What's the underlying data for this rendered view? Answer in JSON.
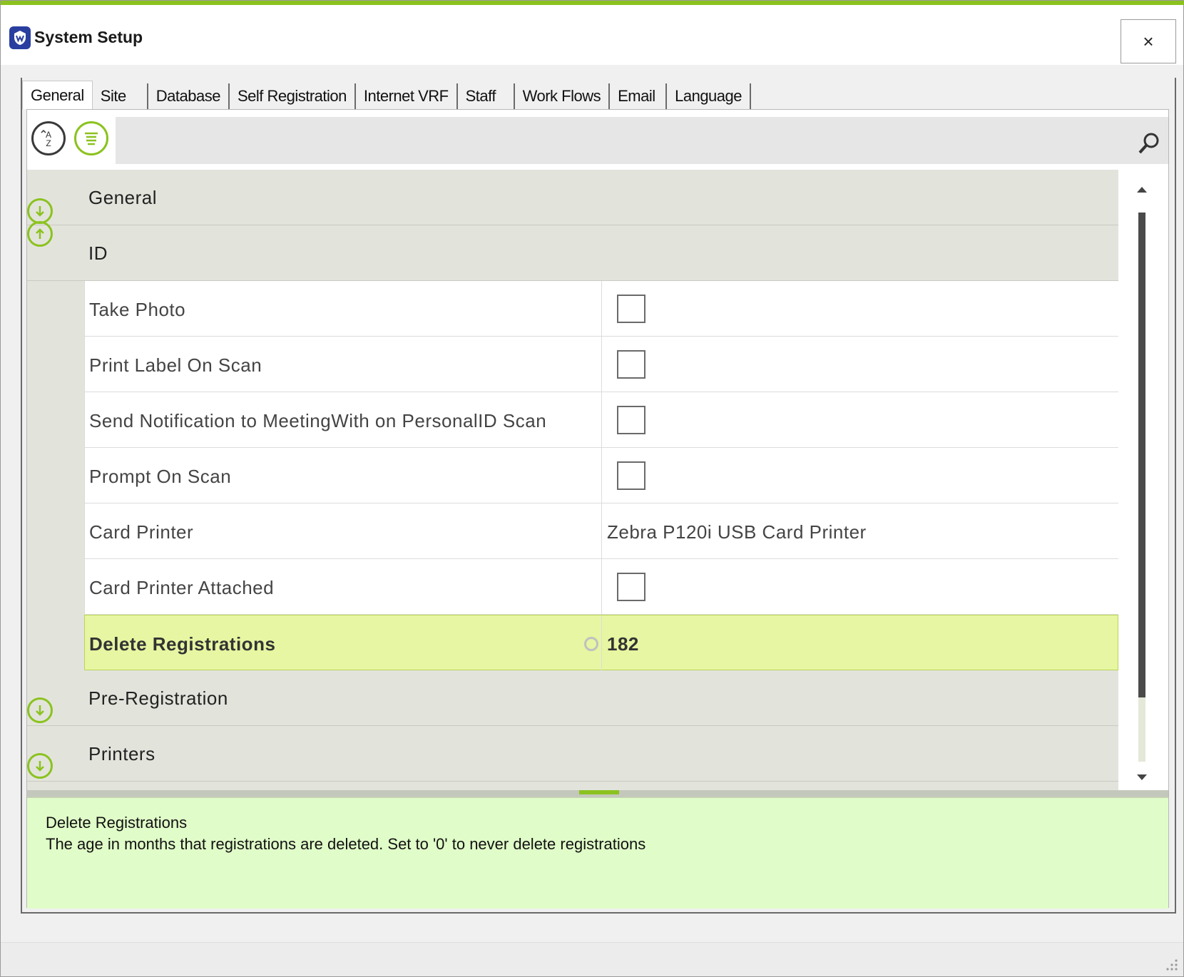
{
  "window": {
    "title": "System Setup",
    "close_label": "×",
    "accent_color": "#8cc21f"
  },
  "tabs": [
    {
      "label": "General",
      "active": true
    },
    {
      "label": "Site",
      "active": false
    },
    {
      "label": "Database",
      "active": false
    },
    {
      "label": "Self Registration",
      "active": false
    },
    {
      "label": "Internet VRF",
      "active": false
    },
    {
      "label": "Staff",
      "active": false
    },
    {
      "label": "Work Flows",
      "active": false
    },
    {
      "label": "Email",
      "active": false
    },
    {
      "label": "Language",
      "active": false
    }
  ],
  "toolbar": {
    "sort_icon": "sort-alphabetical-icon",
    "categorized_icon": "categorized-icon",
    "search_placeholder": "",
    "search_value": ""
  },
  "grid": {
    "categories": [
      {
        "label": "General",
        "expanded": false
      },
      {
        "label": "ID",
        "expanded": true
      },
      {
        "label": "Pre-Registration",
        "expanded": false
      },
      {
        "label": "Printers",
        "expanded": false
      }
    ],
    "id_properties": [
      {
        "name": "Take Photo",
        "type": "checkbox",
        "checked": false,
        "value": ""
      },
      {
        "name": "Print Label On Scan",
        "type": "checkbox",
        "checked": false,
        "value": ""
      },
      {
        "name": "Send Notification to MeetingWith on PersonalID Scan",
        "type": "checkbox",
        "checked": false,
        "value": ""
      },
      {
        "name": "Prompt On Scan",
        "type": "checkbox",
        "checked": false,
        "value": ""
      },
      {
        "name": "Card Printer",
        "type": "text",
        "checked": false,
        "value": "Zebra P120i USB Card Printer"
      },
      {
        "name": "Card Printer Attached",
        "type": "checkbox",
        "checked": false,
        "value": ""
      },
      {
        "name": "Delete Registrations",
        "type": "number",
        "checked": false,
        "value": "182",
        "selected": true
      }
    ]
  },
  "description": {
    "title": "Delete Registrations",
    "text": "The age in months that registrations are deleted. Set to '0' to never delete registrations"
  }
}
